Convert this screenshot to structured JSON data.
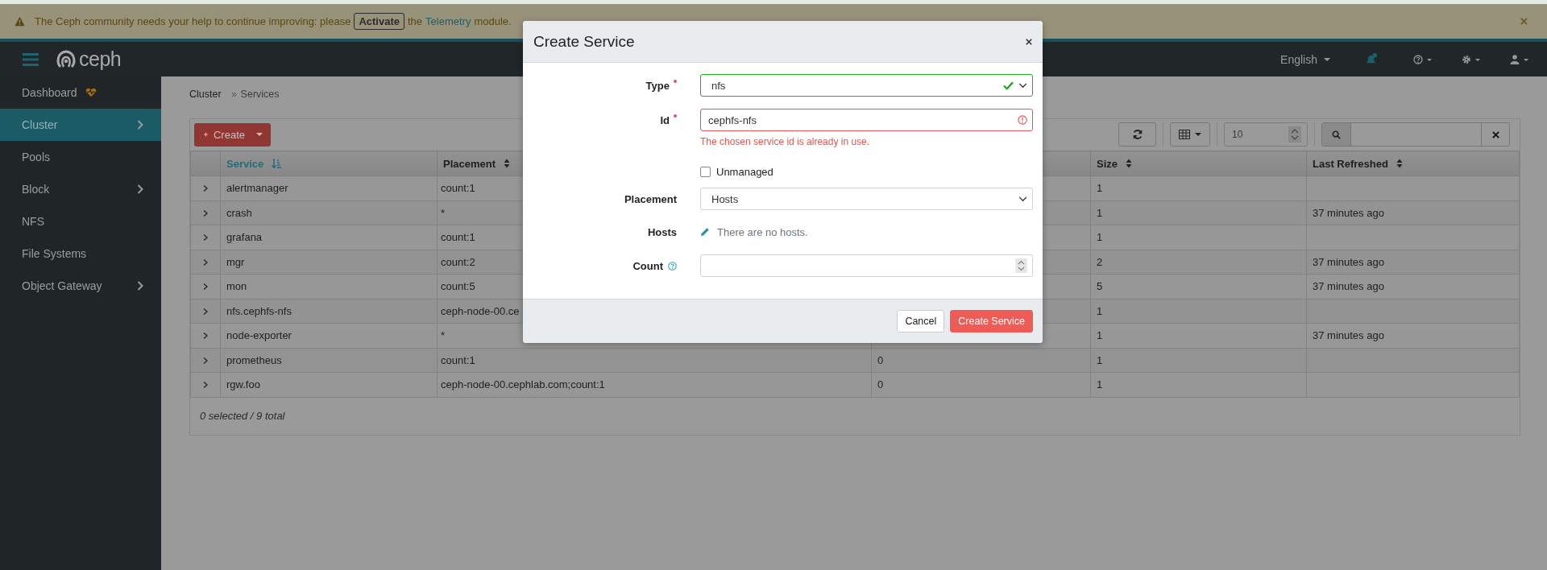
{
  "banner": {
    "parts": [
      {
        "kind": "text",
        "text": "The Ceph community needs your help to continue improving: please"
      },
      {
        "kind": "button",
        "text": "Activate"
      },
      {
        "kind": "text",
        "text": "the"
      },
      {
        "kind": "link",
        "text": "Telemetry"
      },
      {
        "kind": "text",
        "text": "module."
      }
    ]
  },
  "navbar": {
    "logo": "ceph",
    "language": "English"
  },
  "sidebar": {
    "items": [
      {
        "label": "Dashboard",
        "selected": false,
        "expandable": false,
        "health_icon": true
      },
      {
        "label": "Cluster",
        "selected": true,
        "expandable": true,
        "health_icon": false
      },
      {
        "label": "Pools",
        "selected": false,
        "expandable": false,
        "health_icon": false
      },
      {
        "label": "Block",
        "selected": false,
        "expandable": true,
        "health_icon": false
      },
      {
        "label": "NFS",
        "selected": false,
        "expandable": false,
        "health_icon": false
      },
      {
        "label": "File Systems",
        "selected": false,
        "expandable": false,
        "health_icon": false
      },
      {
        "label": "Object Gateway",
        "selected": false,
        "expandable": true,
        "health_icon": false
      }
    ]
  },
  "breadcrumb": [
    "Cluster",
    "Services"
  ],
  "toolbar": {
    "create_button": "Create",
    "page_size": "10"
  },
  "table": {
    "columns": [
      {
        "label": "Service",
        "sorted": true
      },
      {
        "label": "Placement",
        "sorted": false
      },
      {},
      {
        "label": "Size",
        "sorted": false
      },
      {
        "label": "Last Refreshed",
        "sorted": false
      }
    ],
    "rows": [
      {
        "expanded": false,
        "service": "alertmanager",
        "placement": "count:1",
        "size": "1"
      },
      {
        "expanded": false,
        "service": "crash",
        "placement": "*",
        "size": "1",
        "last_refreshed": "37 minutes ago"
      },
      {
        "expanded": false,
        "service": "grafana",
        "placement": "count:1",
        "size": "1"
      },
      {
        "expanded": false,
        "service": "mgr",
        "placement": "count:2",
        "size": "2",
        "last_refreshed": "37 minutes ago"
      },
      {
        "expanded": false,
        "service": "mon",
        "placement": "count:5",
        "size": "5",
        "last_refreshed": "37 minutes ago"
      },
      {
        "expanded": false,
        "service": "nfs.cephfs-nfs",
        "placement": "ceph-node-00.ce",
        "size": "1"
      },
      {
        "expanded": false,
        "service": "node-exporter",
        "placement": "*",
        "size": "1",
        "last_refreshed": "37 minutes ago"
      },
      {
        "expanded": false,
        "service": "prometheus",
        "placement": "count:1",
        "column_4": "0",
        "size": "1"
      },
      {
        "expanded": false,
        "service": "rgw.foo",
        "placement": "ceph-node-00.cephlab.com;count:1",
        "column_4": "0",
        "size": "1"
      }
    ],
    "footer": "0 selected / 9 total"
  },
  "modal": {
    "title": "Create Service",
    "fields": [
      {
        "kind": "select",
        "label": "Type",
        "required": true,
        "value": "nfs",
        "valid": true
      },
      {
        "kind": "text",
        "label": "Id",
        "required": true,
        "value": "cephfs-nfs",
        "valid": false,
        "error": "The chosen service id is already in use."
      },
      {
        "kind": "checkbox",
        "label": "Unmanaged",
        "checked": false
      },
      {
        "kind": "select",
        "label": "Placement",
        "required": false,
        "value": "Hosts"
      },
      {
        "kind": "static",
        "label": "Hosts",
        "text": "There are no hosts."
      },
      {
        "kind": "number",
        "label": "Count",
        "required": false,
        "help": true
      }
    ],
    "buttons": [
      {
        "label": "Cancel",
        "primary": false
      },
      {
        "label": "Create Service",
        "primary": true
      }
    ]
  }
}
